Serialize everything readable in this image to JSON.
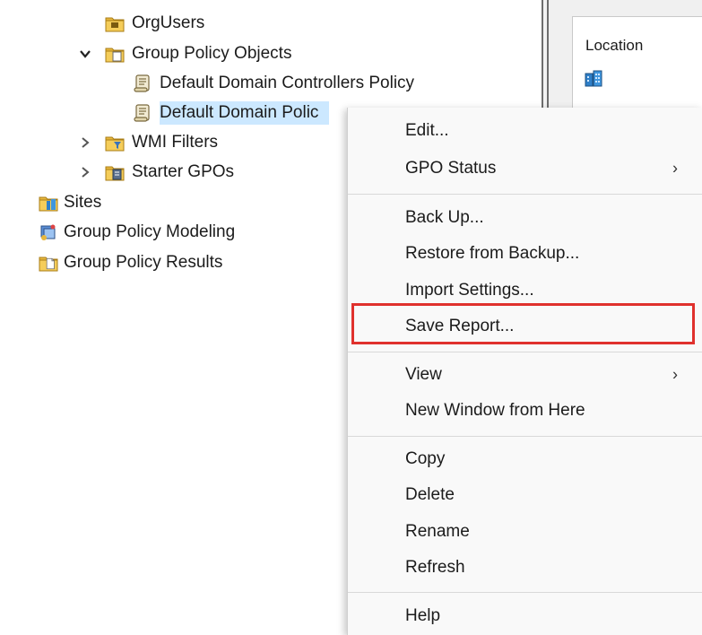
{
  "tree": {
    "nodes": [
      {
        "id": "orgusers",
        "label": "OrgUsers",
        "icon": "ou-folder-icon"
      },
      {
        "id": "gpo",
        "label": "Group Policy Objects",
        "icon": "gpo-folder-icon",
        "expanded": true
      },
      {
        "id": "ddcp",
        "label": "Default Domain Controllers Policy",
        "icon": "gpo-icon"
      },
      {
        "id": "ddp",
        "label": "Default Domain Polic",
        "icon": "gpo-icon",
        "selected": true
      },
      {
        "id": "wmi",
        "label": "WMI Filters",
        "icon": "wmi-filter-folder-icon",
        "expanded": false
      },
      {
        "id": "starter",
        "label": "Starter GPOs",
        "icon": "starter-gpo-folder-icon",
        "expanded": false
      },
      {
        "id": "sites",
        "label": "Sites",
        "icon": "sites-icon"
      },
      {
        "id": "modeling",
        "label": "Group Policy Modeling",
        "icon": "gp-modeling-icon"
      },
      {
        "id": "results",
        "label": "Group Policy Results",
        "icon": "gp-results-icon"
      }
    ]
  },
  "right_pane": {
    "column_header": "Location",
    "icon": "domain-icon"
  },
  "context_menu": {
    "items": [
      {
        "label": "Edit..."
      },
      {
        "label": "GPO Status",
        "submenu": true
      },
      {
        "label": "Back Up..."
      },
      {
        "label": "Restore from Backup..."
      },
      {
        "label": "Import Settings..."
      },
      {
        "label": "Save Report...",
        "highlighted": true
      },
      {
        "label": "View",
        "submenu": true
      },
      {
        "label": "New Window from Here"
      },
      {
        "label": "Copy"
      },
      {
        "label": "Delete"
      },
      {
        "label": "Rename"
      },
      {
        "label": "Refresh"
      },
      {
        "label": "Help"
      }
    ],
    "submenu_arrow": "›"
  },
  "colors": {
    "selection": "#cce8ff",
    "highlight_box": "#e0312d",
    "menu_background": "#f9f9f9"
  }
}
